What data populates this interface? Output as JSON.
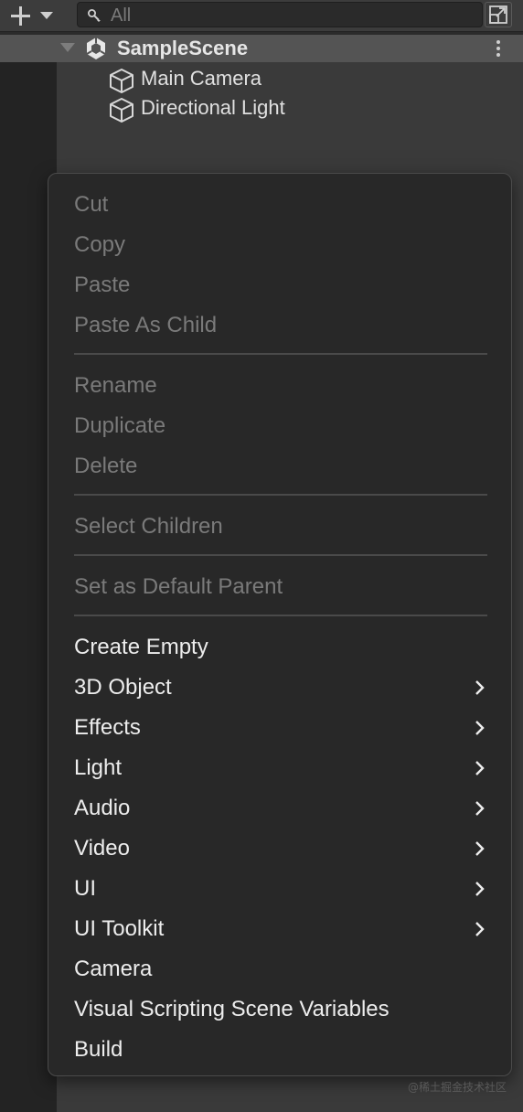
{
  "toolbar": {
    "add_icon": "plus-icon",
    "dropdown_icon": "chevron-down-icon",
    "search": {
      "placeholder": "All",
      "value": ""
    },
    "maximize_icon": "maximize-icon"
  },
  "hierarchy": {
    "scene": {
      "name": "SampleScene",
      "icon": "unity-logo-icon",
      "expanded": true
    },
    "items": [
      {
        "label": "Main Camera",
        "icon": "cube-icon"
      },
      {
        "label": "Directional Light",
        "icon": "cube-icon"
      }
    ]
  },
  "context_menu": {
    "groups": [
      [
        {
          "label": "Cut",
          "enabled": false
        },
        {
          "label": "Copy",
          "enabled": false
        },
        {
          "label": "Paste",
          "enabled": false
        },
        {
          "label": "Paste As Child",
          "enabled": false
        }
      ],
      [
        {
          "label": "Rename",
          "enabled": false
        },
        {
          "label": "Duplicate",
          "enabled": false
        },
        {
          "label": "Delete",
          "enabled": false
        }
      ],
      [
        {
          "label": "Select Children",
          "enabled": false
        }
      ],
      [
        {
          "label": "Set as Default Parent",
          "enabled": false
        }
      ],
      [
        {
          "label": "Create Empty",
          "enabled": true,
          "submenu": false
        },
        {
          "label": "3D Object",
          "enabled": true,
          "submenu": true
        },
        {
          "label": "Effects",
          "enabled": true,
          "submenu": true
        },
        {
          "label": "Light",
          "enabled": true,
          "submenu": true
        },
        {
          "label": "Audio",
          "enabled": true,
          "submenu": true
        },
        {
          "label": "Video",
          "enabled": true,
          "submenu": true
        },
        {
          "label": "UI",
          "enabled": true,
          "submenu": true
        },
        {
          "label": "UI Toolkit",
          "enabled": true,
          "submenu": true
        },
        {
          "label": "Camera",
          "enabled": true,
          "submenu": false
        },
        {
          "label": "Visual Scripting Scene Variables",
          "enabled": true,
          "submenu": false
        },
        {
          "label": "Build",
          "enabled": true,
          "submenu": false
        }
      ]
    ]
  },
  "watermark": "@稀土掘金技术社区",
  "colors": {
    "menu_bg": "#282828",
    "disabled_text": "#7a7a7a",
    "enabled_text": "#ededed",
    "scene_row_bg": "#545454"
  }
}
